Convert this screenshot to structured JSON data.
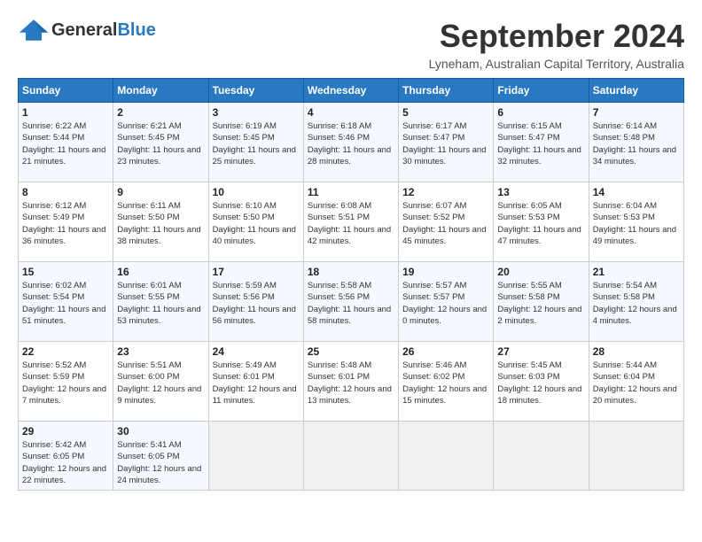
{
  "header": {
    "logo_general": "General",
    "logo_blue": "Blue",
    "month": "September 2024",
    "location": "Lyneham, Australian Capital Territory, Australia"
  },
  "weekdays": [
    "Sunday",
    "Monday",
    "Tuesday",
    "Wednesday",
    "Thursday",
    "Friday",
    "Saturday"
  ],
  "weeks": [
    [
      {
        "day": "1",
        "sunrise": "6:22 AM",
        "sunset": "5:44 PM",
        "daylight": "11 hours and 21 minutes."
      },
      {
        "day": "2",
        "sunrise": "6:21 AM",
        "sunset": "5:45 PM",
        "daylight": "11 hours and 23 minutes."
      },
      {
        "day": "3",
        "sunrise": "6:19 AM",
        "sunset": "5:45 PM",
        "daylight": "11 hours and 25 minutes."
      },
      {
        "day": "4",
        "sunrise": "6:18 AM",
        "sunset": "5:46 PM",
        "daylight": "11 hours and 28 minutes."
      },
      {
        "day": "5",
        "sunrise": "6:17 AM",
        "sunset": "5:47 PM",
        "daylight": "11 hours and 30 minutes."
      },
      {
        "day": "6",
        "sunrise": "6:15 AM",
        "sunset": "5:47 PM",
        "daylight": "11 hours and 32 minutes."
      },
      {
        "day": "7",
        "sunrise": "6:14 AM",
        "sunset": "5:48 PM",
        "daylight": "11 hours and 34 minutes."
      }
    ],
    [
      {
        "day": "8",
        "sunrise": "6:12 AM",
        "sunset": "5:49 PM",
        "daylight": "11 hours and 36 minutes."
      },
      {
        "day": "9",
        "sunrise": "6:11 AM",
        "sunset": "5:50 PM",
        "daylight": "11 hours and 38 minutes."
      },
      {
        "day": "10",
        "sunrise": "6:10 AM",
        "sunset": "5:50 PM",
        "daylight": "11 hours and 40 minutes."
      },
      {
        "day": "11",
        "sunrise": "6:08 AM",
        "sunset": "5:51 PM",
        "daylight": "11 hours and 42 minutes."
      },
      {
        "day": "12",
        "sunrise": "6:07 AM",
        "sunset": "5:52 PM",
        "daylight": "11 hours and 45 minutes."
      },
      {
        "day": "13",
        "sunrise": "6:05 AM",
        "sunset": "5:53 PM",
        "daylight": "11 hours and 47 minutes."
      },
      {
        "day": "14",
        "sunrise": "6:04 AM",
        "sunset": "5:53 PM",
        "daylight": "11 hours and 49 minutes."
      }
    ],
    [
      {
        "day": "15",
        "sunrise": "6:02 AM",
        "sunset": "5:54 PM",
        "daylight": "11 hours and 51 minutes."
      },
      {
        "day": "16",
        "sunrise": "6:01 AM",
        "sunset": "5:55 PM",
        "daylight": "11 hours and 53 minutes."
      },
      {
        "day": "17",
        "sunrise": "5:59 AM",
        "sunset": "5:56 PM",
        "daylight": "11 hours and 56 minutes."
      },
      {
        "day": "18",
        "sunrise": "5:58 AM",
        "sunset": "5:56 PM",
        "daylight": "11 hours and 58 minutes."
      },
      {
        "day": "19",
        "sunrise": "5:57 AM",
        "sunset": "5:57 PM",
        "daylight": "12 hours and 0 minutes."
      },
      {
        "day": "20",
        "sunrise": "5:55 AM",
        "sunset": "5:58 PM",
        "daylight": "12 hours and 2 minutes."
      },
      {
        "day": "21",
        "sunrise": "5:54 AM",
        "sunset": "5:58 PM",
        "daylight": "12 hours and 4 minutes."
      }
    ],
    [
      {
        "day": "22",
        "sunrise": "5:52 AM",
        "sunset": "5:59 PM",
        "daylight": "12 hours and 7 minutes."
      },
      {
        "day": "23",
        "sunrise": "5:51 AM",
        "sunset": "6:00 PM",
        "daylight": "12 hours and 9 minutes."
      },
      {
        "day": "24",
        "sunrise": "5:49 AM",
        "sunset": "6:01 PM",
        "daylight": "12 hours and 11 minutes."
      },
      {
        "day": "25",
        "sunrise": "5:48 AM",
        "sunset": "6:01 PM",
        "daylight": "12 hours and 13 minutes."
      },
      {
        "day": "26",
        "sunrise": "5:46 AM",
        "sunset": "6:02 PM",
        "daylight": "12 hours and 15 minutes."
      },
      {
        "day": "27",
        "sunrise": "5:45 AM",
        "sunset": "6:03 PM",
        "daylight": "12 hours and 18 minutes."
      },
      {
        "day": "28",
        "sunrise": "5:44 AM",
        "sunset": "6:04 PM",
        "daylight": "12 hours and 20 minutes."
      }
    ],
    [
      {
        "day": "29",
        "sunrise": "5:42 AM",
        "sunset": "6:05 PM",
        "daylight": "12 hours and 22 minutes."
      },
      {
        "day": "30",
        "sunrise": "5:41 AM",
        "sunset": "6:05 PM",
        "daylight": "12 hours and 24 minutes."
      },
      null,
      null,
      null,
      null,
      null
    ]
  ],
  "labels": {
    "sunrise": "Sunrise: ",
    "sunset": "Sunset: ",
    "daylight": "Daylight: "
  }
}
